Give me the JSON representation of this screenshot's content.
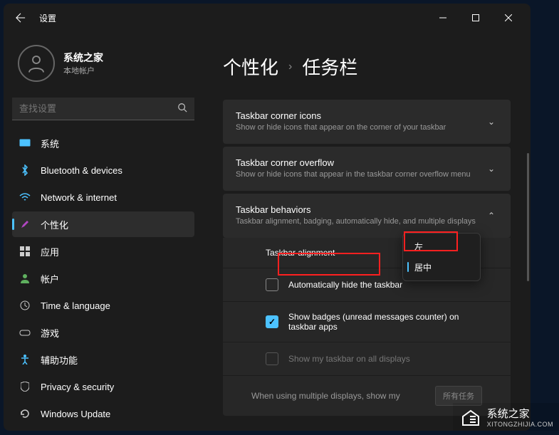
{
  "window": {
    "title": "设置"
  },
  "user": {
    "name": "系统之家",
    "account_type": "本地帐户"
  },
  "search": {
    "placeholder": "查找设置"
  },
  "nav": [
    {
      "id": "system",
      "label": "系统",
      "icon_color": "#4cc2ff"
    },
    {
      "id": "bluetooth",
      "label": "Bluetooth & devices",
      "icon_color": "#4cc2ff"
    },
    {
      "id": "network",
      "label": "Network & internet",
      "icon_color": "#4cc2ff"
    },
    {
      "id": "personalization",
      "label": "个性化",
      "icon_color": "#b146c2",
      "active": true
    },
    {
      "id": "apps",
      "label": "应用",
      "icon_color": "#ccc"
    },
    {
      "id": "accounts",
      "label": "帐户",
      "icon_color": "#5fb05f"
    },
    {
      "id": "time",
      "label": "Time & language",
      "icon_color": "#ccc"
    },
    {
      "id": "gaming",
      "label": "游戏",
      "icon_color": "#ccc"
    },
    {
      "id": "accessibility",
      "label": "辅助功能",
      "icon_color": "#4cc2ff"
    },
    {
      "id": "privacy",
      "label": "Privacy & security",
      "icon_color": "#ccc"
    },
    {
      "id": "update",
      "label": "Windows Update",
      "icon_color": "#ccc"
    }
  ],
  "breadcrumb": {
    "parent": "个性化",
    "current": "任务栏"
  },
  "cards": {
    "corner_icons": {
      "title": "Taskbar corner icons",
      "sub": "Show or hide icons that appear on the corner of your taskbar"
    },
    "corner_overflow": {
      "title": "Taskbar corner overflow",
      "sub": "Show or hide icons that appear in the taskbar corner overflow menu"
    },
    "behaviors": {
      "title": "Taskbar behaviors",
      "sub": "Taskbar alignment, badging, automatically hide, and multiple displays"
    }
  },
  "behaviors": {
    "alignment_label": "Taskbar alignment",
    "alignment_options": {
      "left": "左",
      "center": "居中"
    },
    "auto_hide": {
      "label": "Automatically hide the taskbar",
      "checked": false
    },
    "badges": {
      "label": "Show badges (unread messages counter) on taskbar apps",
      "checked": true
    },
    "all_displays": {
      "label": "Show my taskbar on all displays",
      "checked": false,
      "disabled": true
    },
    "multi_display": {
      "label": "When using multiple displays, show my",
      "value": "所有任务"
    }
  },
  "watermark": {
    "name": "系统之家",
    "url": "XITONGZHIJIA.COM"
  }
}
